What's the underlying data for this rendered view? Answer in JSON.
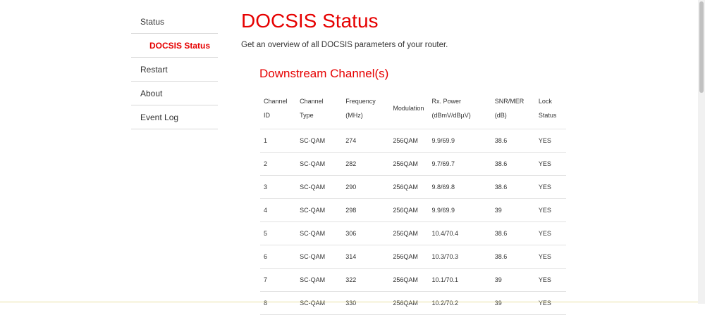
{
  "sidebar": {
    "items": [
      {
        "label": "Status"
      },
      {
        "label": "DOCSIS Status"
      },
      {
        "label": "Restart"
      },
      {
        "label": "About"
      },
      {
        "label": "Event Log"
      }
    ]
  },
  "main": {
    "title": "DOCSIS Status",
    "description": "Get an overview of all DOCSIS parameters of your router.",
    "downstream": {
      "title": "Downstream Channel(s)",
      "headers": [
        [
          "Channel",
          "ID"
        ],
        [
          "Channel Type"
        ],
        [
          "Frequency",
          "(MHz)"
        ],
        [
          "Modulation"
        ],
        [
          "Rx. Power",
          "(dBmV/dBµV)"
        ],
        [
          "SNR/MER",
          "(dB)"
        ],
        [
          "Lock",
          "Status"
        ]
      ],
      "rows": [
        [
          "1",
          "SC-QAM",
          "274",
          "256QAM",
          "9.9/69.9",
          "38.6",
          "YES"
        ],
        [
          "2",
          "SC-QAM",
          "282",
          "256QAM",
          "9.7/69.7",
          "38.6",
          "YES"
        ],
        [
          "3",
          "SC-QAM",
          "290",
          "256QAM",
          "9.8/69.8",
          "38.6",
          "YES"
        ],
        [
          "4",
          "SC-QAM",
          "298",
          "256QAM",
          "9.9/69.9",
          "39",
          "YES"
        ],
        [
          "5",
          "SC-QAM",
          "306",
          "256QAM",
          "10.4/70.4",
          "38.6",
          "YES"
        ],
        [
          "6",
          "SC-QAM",
          "314",
          "256QAM",
          "10.3/70.3",
          "38.6",
          "YES"
        ],
        [
          "7",
          "SC-QAM",
          "322",
          "256QAM",
          "10.1/70.1",
          "39",
          "YES"
        ],
        [
          "8",
          "SC-QAM",
          "330",
          "256QAM",
          "10.2/70.2",
          "39",
          "YES"
        ]
      ]
    }
  },
  "colors": {
    "accent": "#e60000",
    "text": "#333333",
    "divider": "#d8d8d8"
  }
}
